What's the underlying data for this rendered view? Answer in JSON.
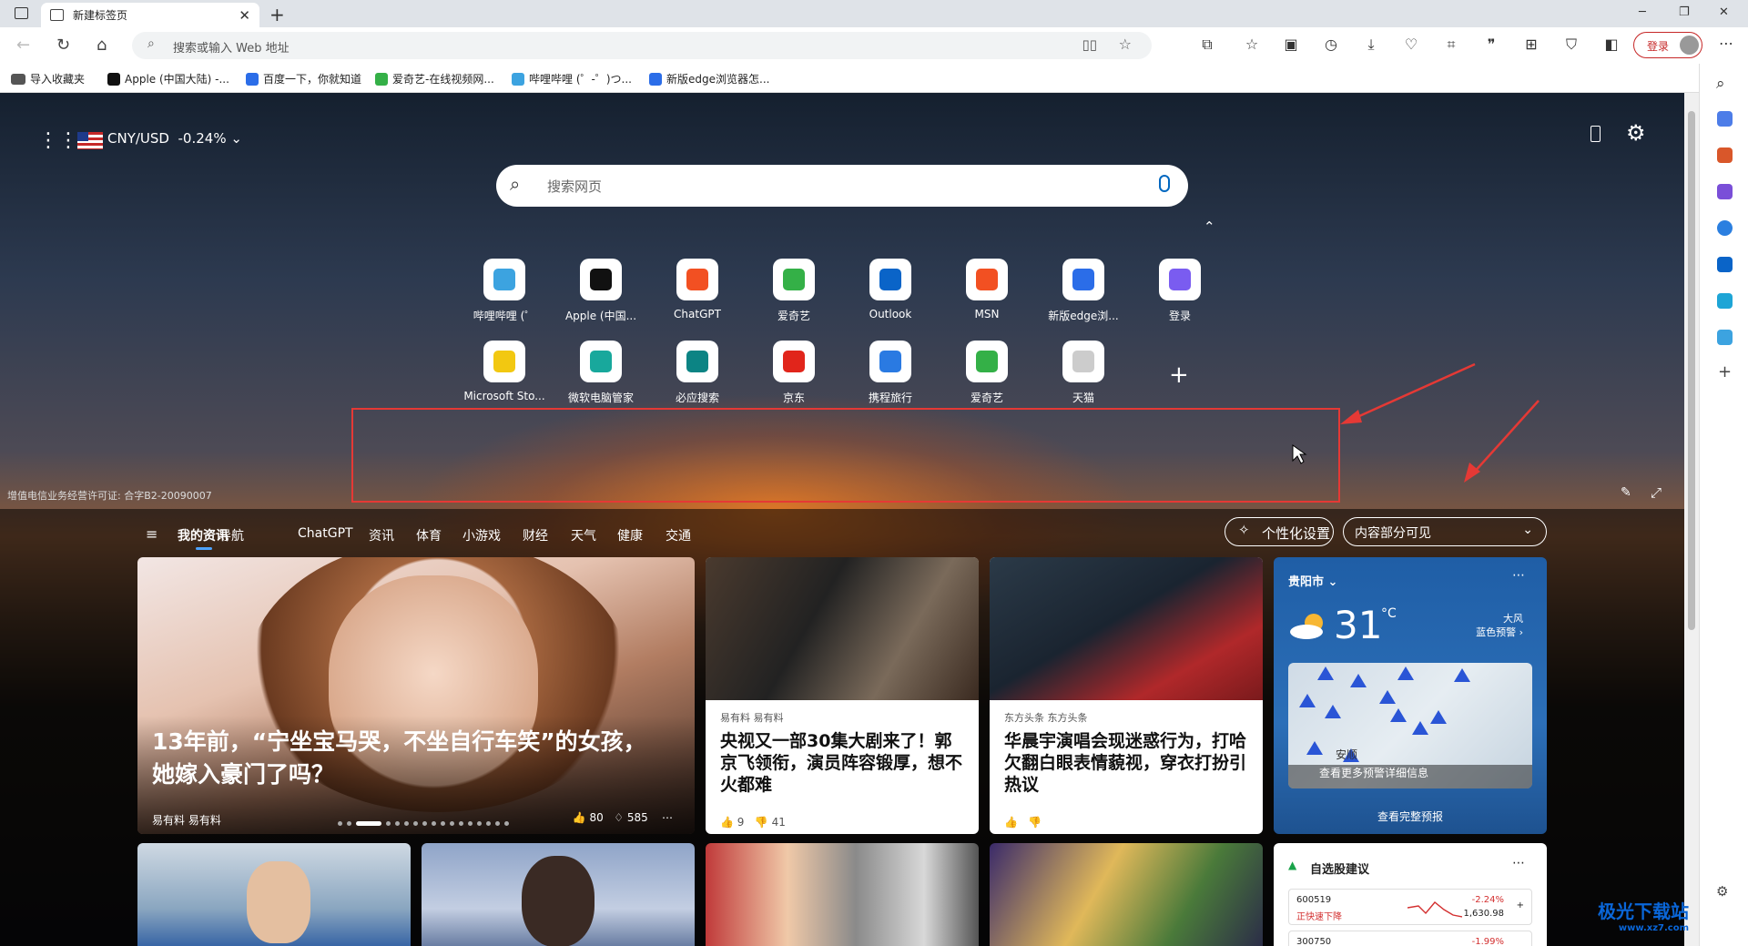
{
  "browser": {
    "tab_title": "新建标签页",
    "address_placeholder": "搜索或输入 Web 地址",
    "login_label": "登录"
  },
  "bookmarks": [
    {
      "label": "导入收藏夹",
      "color": "#333333"
    },
    {
      "label": "Apple (中国大陆) -...",
      "color": "#111111"
    },
    {
      "label": "百度一下，你就知道",
      "color": "#2b6de8"
    },
    {
      "label": "爱奇艺-在线视频网...",
      "color": "#34b047"
    },
    {
      "label": "哔哩哔哩 (゜-゜)つ...",
      "color": "#3ca3e0"
    },
    {
      "label": "新版edge浏览器怎...",
      "color": "#2b6de8"
    }
  ],
  "ntp": {
    "currency_pair": "CNY/USD",
    "currency_change": "-0.24%",
    "search_placeholder": "搜索网页",
    "tiles_row1": [
      {
        "label": "哔哩哔哩 (゜",
        "color": "#3ca3e0"
      },
      {
        "label": "Apple (中国...",
        "color": "#111111"
      },
      {
        "label": "ChatGPT",
        "color": "#f25022"
      },
      {
        "label": "爱奇艺",
        "color": "#34b047"
      },
      {
        "label": "Outlook",
        "color": "#0a64c8"
      },
      {
        "label": "MSN",
        "color": "#f25022"
      },
      {
        "label": "新版edge浏...",
        "color": "#2b6de8"
      },
      {
        "label": "登录",
        "color": "#7a5cf0"
      }
    ],
    "tiles_row2": [
      {
        "label": "Microsoft Sto...",
        "color": "#f2c811"
      },
      {
        "label": "微软电脑管家",
        "color": "#18a89c"
      },
      {
        "label": "必应搜索",
        "color": "#0c8484"
      },
      {
        "label": "京东",
        "color": "#e1251b"
      },
      {
        "label": "携程旅行",
        "color": "#2a7ae2"
      },
      {
        "label": "爱奇艺",
        "color": "#34b047"
      },
      {
        "label": "天猫",
        "color": "#cccccc"
      }
    ],
    "license": "增值电信业务经营许可证: 合字B2-20090007"
  },
  "news": {
    "tabs": [
      "我的资讯",
      "导航",
      "ChatGPT",
      "资讯",
      "体育",
      "小游戏",
      "财经",
      "天气",
      "健康",
      "交通"
    ],
    "personalize": "个性化设置",
    "visibility": "内容部分可见",
    "hero": {
      "title": "13年前，“宁坐宝马哭，不坐自行车笑”的女孩，她嫁入豪门了吗？",
      "source": "易有料  易有料",
      "likes": "80",
      "comments": "585"
    },
    "card1": {
      "source": "易有料  易有料",
      "title": "央视又一部30集大剧来了！郭京飞领衔，演员阵容锻厚，想不火都难",
      "likes": "9",
      "dislikes": "41"
    },
    "card2": {
      "source": "东方头条  东方头条",
      "title": "华晨宇演唱会现迷惑行为，打哈欠翻白眼表情藐视，穿衣打扮引热议"
    },
    "weather": {
      "city": "贵阳市",
      "temp": "31",
      "unit": "°C",
      "warning": "大风\n蓝色预警",
      "map_text": "查看更多预警详细信息",
      "map_city": "安顺",
      "full": "查看完整预报"
    },
    "stocks": {
      "title": "自选股建议",
      "rows": [
        {
          "code": "600519",
          "desc": "正快速下降",
          "change": "-2.24%",
          "price": "1,630.98"
        },
        {
          "code": "300750",
          "desc": "",
          "change": "-1.99%",
          "price": ""
        }
      ]
    }
  },
  "watermark": {
    "name": "极光下载站",
    "url": "www.xz7.com"
  }
}
